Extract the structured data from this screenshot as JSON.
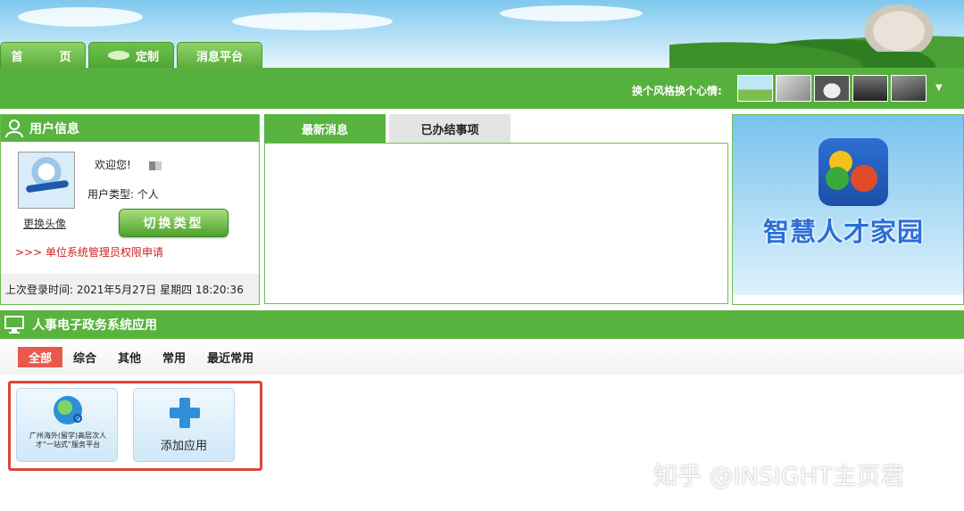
{
  "tabs": [
    {
      "label": "首　页"
    },
    {
      "label": "定制"
    },
    {
      "label": "消息平台"
    }
  ],
  "toolbar": {
    "skin_label": "换个风格换个心情:",
    "skins": [
      "skin-landscape",
      "skin-jets",
      "skin-car",
      "skin-dark",
      "skin-sports-car"
    ]
  },
  "user_panel": {
    "title": "用户信息",
    "change_avatar": "更换头像",
    "welcome": "欢迎您!",
    "user_type_label": "用户类型:",
    "user_type_value": "个人",
    "switch_button": "切换类型",
    "apply_link": ">>> 单位系统管理员权限申请",
    "last_login": "上次登录时间: 2021年5月27日 星期四 18:20:36"
  },
  "news_panel": {
    "tabs": [
      {
        "label": "最新消息"
      },
      {
        "label": "已办结事项"
      }
    ]
  },
  "promo": {
    "title": "智慧人才家园"
  },
  "apps": {
    "title": "人事电子政务系统应用",
    "filters": [
      "全部",
      "综合",
      "其他",
      "常用",
      "最近常用"
    ],
    "cards": [
      {
        "label": "广州海外(留学)高层次人才“一站式”服务平台"
      },
      {
        "label": "添加应用"
      }
    ]
  },
  "watermark": "知乎 @INSIGHT主页君",
  "colors": {
    "accent_green": "#58b33f",
    "highlight_red": "#e0453a",
    "filter_active": "#e8584c",
    "link_red": "#d02020"
  }
}
